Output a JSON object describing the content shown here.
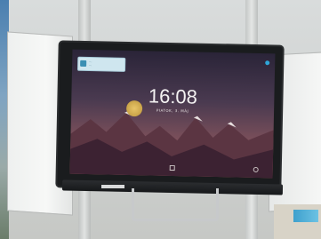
{
  "scene": {
    "screen": {
      "notification": {
        "line1": "...",
        "line2": "..."
      },
      "clock": "16:08",
      "date": "PIATOK, 3. MÁJ"
    },
    "brand": ""
  }
}
